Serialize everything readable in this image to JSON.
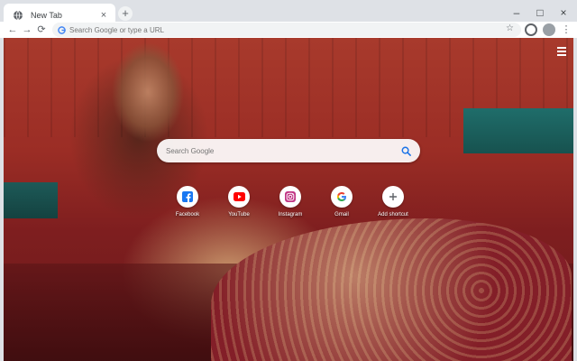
{
  "tab": {
    "title": "New Tab",
    "close": "×"
  },
  "newtab": {
    "label": "+"
  },
  "window": {
    "minimize": "–",
    "maximize": "□",
    "close": "×"
  },
  "toolbar": {
    "back": "←",
    "forward": "→",
    "reload": "⟳",
    "omnibox_placeholder": "Search Google or type a URL",
    "star": "☆",
    "menu": "⋮"
  },
  "page": {
    "menu_icon": "hamburger-icon",
    "search_placeholder": "Search Google",
    "shortcuts": [
      {
        "label": "Facebook",
        "icon": "facebook-icon",
        "color": "#1877f2"
      },
      {
        "label": "YouTube",
        "icon": "youtube-icon",
        "color": "#ff0000"
      },
      {
        "label": "Instagram",
        "icon": "instagram-icon",
        "color": "#c13584"
      },
      {
        "label": "Gmail",
        "icon": "google-icon",
        "color": "#4285f4"
      },
      {
        "label": "Add shortcut",
        "icon": "plus-icon",
        "color": "#5f6368"
      }
    ]
  },
  "colors": {
    "accent": "#1a73e8",
    "tabstrip": "#dee1e6",
    "toolbar": "#ffffff"
  }
}
